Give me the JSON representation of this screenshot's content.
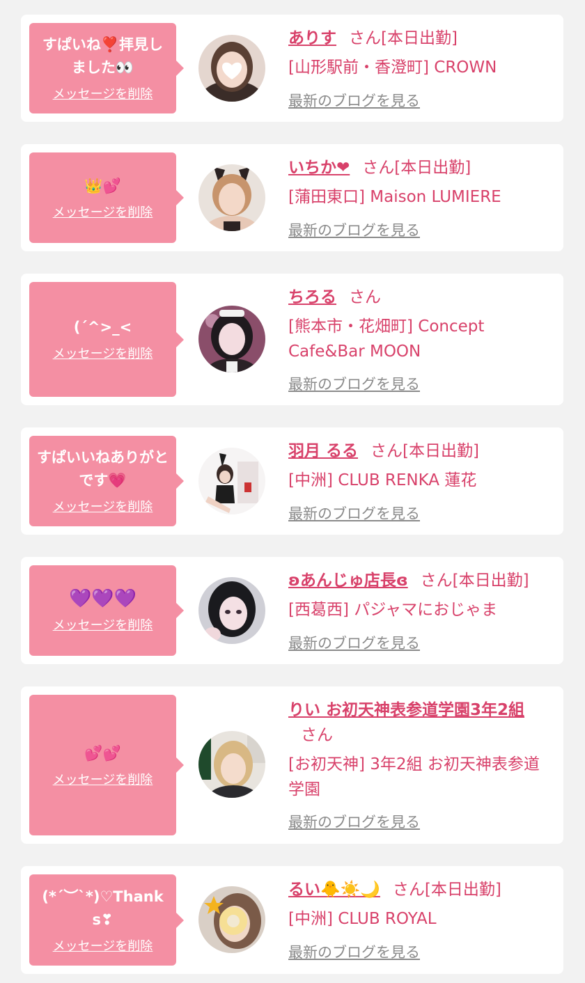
{
  "delete_label": "メッセージを削除",
  "blog_label": "最新のブログを見る",
  "san_label": "さん",
  "colors": {
    "accent": "#d8416a",
    "bubble": "#f48fa3",
    "link_gray": "#8a8a8a"
  },
  "items": [
    {
      "message": "すぱいね❣️拝見しました👀",
      "name": "ありす",
      "status": "[本日出勤]",
      "shop": "[山形駅前・香澄町] CROWN"
    },
    {
      "message": "👑💕",
      "name": "いちか❤",
      "status": "[本日出勤]",
      "shop": "[蒲田東口] Maison LUMIERE"
    },
    {
      "message": "(ˊ^>_<",
      "name": "ちろる",
      "status": "",
      "shop": "[熊本市・花畑町] Concept Cafe&Bar MOON"
    },
    {
      "message": "すぱいいねありがとです💗",
      "name": "羽月 るる",
      "status": "[本日出勤]",
      "shop": "[中洲] CLUB RENKA 蓮花"
    },
    {
      "message": "💜💜💜",
      "name": "ʚあんじゅ店長ɞ",
      "status": "[本日出勤]",
      "shop": "[西葛西] パジャマにおじゃま"
    },
    {
      "message": "💕💕",
      "name": "りい お初天神表参道学園3年2組",
      "status": "",
      "shop": "[お初天神] 3年2組 お初天神表参道学園"
    },
    {
      "message": "(*´︶`*)♡Thanks❣",
      "name": "るい🐥☀️🌙",
      "status": "[本日出勤]",
      "shop": "[中洲] CLUB ROYAL"
    }
  ]
}
